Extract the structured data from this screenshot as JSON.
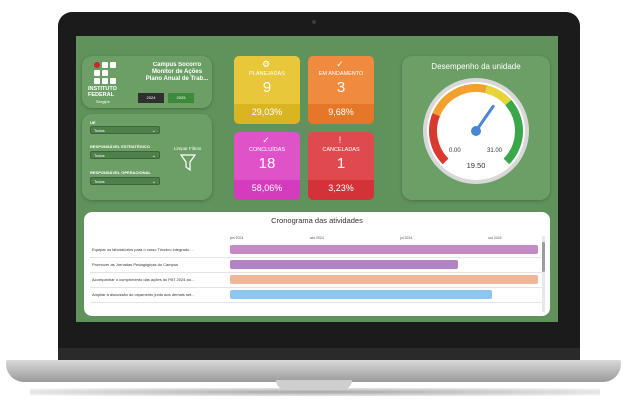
{
  "header": {
    "logo_line1": "INSTITUTO",
    "logo_line2": "FEDERAL",
    "logo_sub": "Sergipe",
    "title_line1": "Campus Socorro",
    "title_line2": "Monitor de Ações",
    "title_line3": "Plano Anual de Trab...",
    "years": [
      "2024",
      "2025"
    ]
  },
  "filters": {
    "f1_label": "UE",
    "f1_value": "Todos",
    "f2_label": "RESPONSÁVEL ESTRATÉGICO",
    "f2_value": "Todos",
    "f3_label": "RESPONSÁVEL OPERACIONAL",
    "f3_value": "Todos",
    "clear_label": "Limpar Filtros"
  },
  "kpis": [
    {
      "label": "PLANEJADAS",
      "count": "9",
      "percent": "29,03%",
      "icon": "planned-icon",
      "color_top": "#e8c73b",
      "color_bottom": "#d9b522"
    },
    {
      "label": "EM ANDAMENTO",
      "count": "3",
      "percent": "9,68%",
      "icon": "check-circle-icon",
      "color_top": "#ef8a3e",
      "color_bottom": "#e67628"
    },
    {
      "label": "CONCLUÍDAS",
      "count": "18",
      "percent": "58,06%",
      "icon": "check-circle-icon",
      "color_top": "#e052c8",
      "color_bottom": "#d43bbd"
    },
    {
      "label": "CANCELADAS",
      "count": "1",
      "percent": "3,23%",
      "icon": "alert-icon",
      "color_top": "#e04a4e",
      "color_bottom": "#d23238"
    }
  ],
  "gauge": {
    "title": "Desempenho da unidade",
    "min_label": "0.00",
    "max_label": "31.00",
    "value_label": "19.50",
    "value": 19.5,
    "min": 0,
    "max": 31
  },
  "gantt": {
    "title": "Cronograma das atividades",
    "ticks": [
      "jan 2024",
      "abr 2024",
      "jul 2024",
      "out 2024"
    ],
    "tasks": [
      {
        "name": "Equipar os laboratórios para o curso Técnico integrado ...",
        "color": "#c48ac6",
        "start": 0.0,
        "end": 1.0
      },
      {
        "name": "Promover as Jornadas Pedagógicas do Campus",
        "color": "#b583c5",
        "start": 0.0,
        "end": 0.74
      },
      {
        "name": "Acompanhar o cumprimento das ações do PAT 2024 ao...",
        "color": "#f0b796",
        "start": 0.0,
        "end": 1.0
      },
      {
        "name": "Ampliar a discussão do orçamento junto aos demais set...",
        "color": "#8ec6f2",
        "start": 0.0,
        "end": 0.85
      }
    ]
  }
}
